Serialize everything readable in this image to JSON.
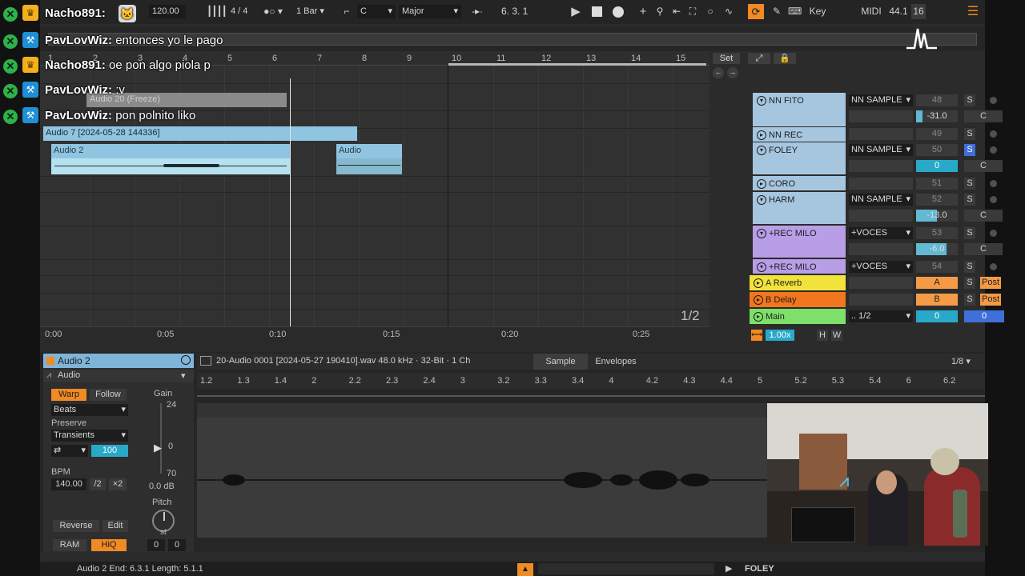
{
  "transport": {
    "tempo": "120.00",
    "time_sig_num": "4",
    "time_sig_den": "4",
    "quantize": "1 Bar",
    "key": "C",
    "scale": "Major",
    "position": "6.  3.  1",
    "key_label": "Key",
    "midi_label": "MIDI",
    "sample_rate": "44.1",
    "cpu": "16"
  },
  "ruler": {
    "bars": [
      "1",
      "2",
      "3",
      "4",
      "5",
      "6",
      "7",
      "8",
      "9",
      "10",
      "11",
      "12",
      "13",
      "14",
      "15"
    ],
    "set_label": "Set"
  },
  "clips": {
    "freeze": "Audio 20 (Freeze)",
    "audio7": "Audio 7 [2024-05-28 144336]",
    "audio2": "Audio 2",
    "audio": "Audio"
  },
  "timeline": {
    "times": [
      "0:00",
      "0:05",
      "0:10",
      "0:15",
      "0:20",
      "0:25"
    ],
    "zoom_fraction": "1/2"
  },
  "mixer": {
    "tracks": [
      {
        "name": "NN FITO",
        "io": "NN SAMPLE",
        "num": "48",
        "vol": "-31.0",
        "pan": "C",
        "color": "#a6c6e0",
        "solo": false
      },
      {
        "name": "NN REC",
        "io": "",
        "num": "49",
        "vol": "",
        "pan": "",
        "color": "#a6c6e0",
        "solo": false
      },
      {
        "name": "FOLEY",
        "io": "NN SAMPLE",
        "num": "50",
        "vol": "0",
        "pan": "C",
        "color": "#a6c6e0",
        "solo": true
      },
      {
        "name": "CORO",
        "io": "",
        "num": "51",
        "vol": "",
        "pan": "",
        "color": "#a6c6e0",
        "solo": false
      },
      {
        "name": "HARM",
        "io": "NN SAMPLE",
        "num": "52",
        "vol": "-13.0",
        "pan": "C",
        "color": "#a6c6e0",
        "solo": false
      },
      {
        "name": "+REC MILO",
        "io": "+VOCES",
        "num": "53",
        "vol": "-6.0",
        "pan": "C",
        "color": "#b89ee6",
        "solo": false
      },
      {
        "name": "+REC MILO",
        "io": "+VOCES",
        "num": "54",
        "vol": "",
        "pan": "",
        "color": "#b89ee6",
        "solo": false
      }
    ],
    "returns": [
      {
        "name": "A Reverb",
        "letter": "A",
        "post": "Post",
        "color": "#f2e33b",
        "btn_color": "#f59a46"
      },
      {
        "name": "B Delay",
        "letter": "B",
        "post": "Post",
        "color": "#f2761d",
        "btn_color": "#f59a46"
      }
    ],
    "main": {
      "name": "Main",
      "io": ".. 1/2",
      "vol": "0",
      "pan": "0",
      "color": "#7ee06a"
    },
    "zoom": "1.00x",
    "h_label": "H",
    "w_label": "W"
  },
  "detail": {
    "clip_name": "Audio 2",
    "clip_type": "Audio",
    "warp": "Warp",
    "follow": "Follow",
    "warp_mode": "Beats",
    "preserve_label": "Preserve",
    "preserve": "Transients",
    "transient_val": "100",
    "bpm_label": "BPM",
    "bpm": "140.00",
    "half": "/2",
    "double": "×2",
    "gain_label": "Gain",
    "gain_top": "24",
    "gain_mid": "0",
    "gain_bottom": "70",
    "gain_db": "0.0 dB",
    "pitch_label": "Pitch",
    "pitch_unit": "st",
    "pitch_st": "0",
    "pitch_ct": "0",
    "reverse": "Reverse",
    "edit": "Edit",
    "ram": "RAM",
    "hiq": "HiQ",
    "file_info": "20-Audio 0001 [2024-05-27 190410].wav  48.0 kHz · 32-Bit · 1 Ch",
    "tab_sample": "Sample",
    "tab_envelopes": "Envelopes",
    "grid": "1/8",
    "ruler": [
      "1.2",
      "1.3",
      "1.4",
      "2",
      "2.2",
      "2.3",
      "2.4",
      "3",
      "3.2",
      "3.3",
      "3.4",
      "4",
      "4.2",
      "4.3",
      "4.4",
      "5",
      "5.2",
      "5.3",
      "5.4",
      "6",
      "6.2"
    ]
  },
  "status": {
    "text": "Audio 2  End: 6.3.1  Length: 5.1.1",
    "track": "FOLEY"
  },
  "chat": [
    {
      "user": "Nacho891:",
      "msg": "",
      "badge": "crown"
    },
    {
      "user": "PavLovWiz:",
      "msg": "entonces yo le pago",
      "badge": "wrench"
    },
    {
      "user": "Nacho891:",
      "msg": "oe pon algo piola p",
      "badge": "crown"
    },
    {
      "user": "PavLovWiz:",
      "msg": ":v",
      "badge": "wrench"
    },
    {
      "user": "PavLovWiz:",
      "msg": "pon polnito liko",
      "badge": "wrench"
    }
  ]
}
